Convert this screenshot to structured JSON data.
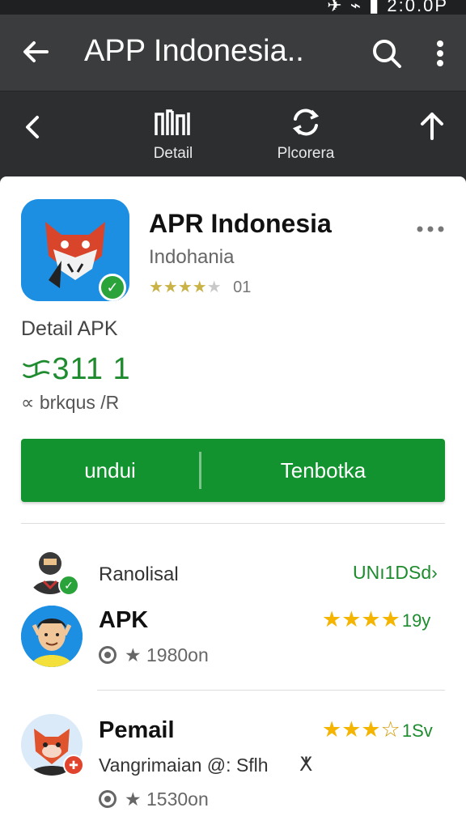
{
  "status_bar": {
    "time": "2:0.0P"
  },
  "app_bar": {
    "title": "APP Indonesia.."
  },
  "tabs": [
    {
      "label": "Detail",
      "icon": "app-grid-icon",
      "active": true
    },
    {
      "label": "Plcorera",
      "icon": "refresh-icon",
      "active": false
    }
  ],
  "app": {
    "name": "APR Indonesia",
    "subtitle": "Indohania",
    "rating_value": "01",
    "stars_filled": 4,
    "stars_total": 5
  },
  "details": {
    "label": "Detail APK",
    "version": "ᜃ311 1",
    "package": "∝ brkqus /R"
  },
  "actions": {
    "download_label": "undui",
    "open_label": "Tenbotka"
  },
  "related": {
    "header_label": "Ranolisal",
    "header_link": "UNı1DSd",
    "items": [
      {
        "title": "APK",
        "meta": "★ 1980on",
        "stars_filled": 4,
        "rating_count": "19y"
      },
      {
        "title": "Pemail",
        "subline": "Vangrimaian @: Sflh",
        "meta": "★ 1530on",
        "stars_filled": 3,
        "rating_count": "1Sv"
      }
    ]
  },
  "colors": {
    "accent_green": "#13932f",
    "app_bar": "#3a3c3e",
    "star_gold": "#f4b400"
  }
}
